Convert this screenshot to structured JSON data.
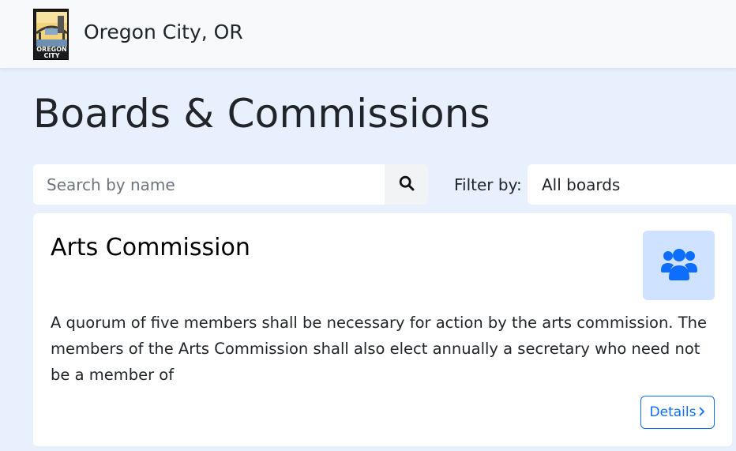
{
  "header": {
    "logo_text_line1": "OREGON",
    "logo_text_line2": "CITY",
    "brand": "Oregon City, OR"
  },
  "page": {
    "title": "Boards & Commissions"
  },
  "search": {
    "placeholder": "Search by name",
    "icon": "search-icon"
  },
  "filter": {
    "label": "Filter by:",
    "selected": "All boards"
  },
  "boards": [
    {
      "name": "Arts Commission",
      "icon": "users-icon",
      "description": "A quorum of five members shall be necessary for action by the arts commission. The members of the Arts Commission shall also elect annually a secretary who need not be a member of",
      "details_label": "Details"
    }
  ],
  "colors": {
    "page_background": "#e8f0fe",
    "navbar_background": "#f8f9fa",
    "accent": "#0d6efd",
    "icon_box": "#cfe2ff"
  }
}
